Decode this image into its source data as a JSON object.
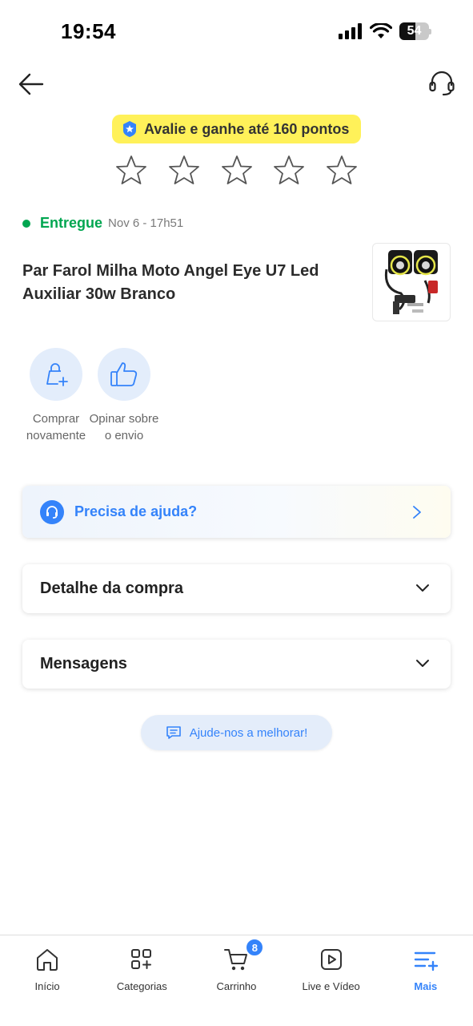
{
  "status_bar": {
    "time": "19:54",
    "battery": "54",
    "battery_level": 0.54
  },
  "promo": {
    "text": "Avalie e ganhe até 160 pontos"
  },
  "rating": {
    "stars": 5,
    "selected": 0
  },
  "order": {
    "status": "Entregue",
    "date": "Nov 6 - 17h51",
    "status_color": "#00a650",
    "product_title": "Par Farol Milha Moto Angel Eye U7 Led Auxiliar 30w Branco"
  },
  "actions": [
    {
      "label": "Comprar novamente",
      "icon": "bag-plus-icon"
    },
    {
      "label": "Opinar sobre o envio",
      "icon": "thumbs-up-icon"
    }
  ],
  "help": {
    "label": "Precisa de ajuda?"
  },
  "accordions": [
    {
      "label": "Detalhe da compra"
    },
    {
      "label": "Mensagens"
    }
  ],
  "feedback": {
    "label": "Ajude-nos a melhorar!"
  },
  "tab_bar": {
    "active": "Mais",
    "tabs": [
      {
        "label": "Início",
        "icon": "home-icon"
      },
      {
        "label": "Categorias",
        "icon": "grid-icon"
      },
      {
        "label": "Carrinho",
        "icon": "cart-icon",
        "badge": "8"
      },
      {
        "label": "Live e Vídeo",
        "icon": "play-icon"
      },
      {
        "label": "Mais",
        "icon": "menu-plus-icon"
      }
    ]
  },
  "colors": {
    "accent": "#3483fa",
    "promo_bg": "#fff159",
    "success": "#00a650"
  }
}
